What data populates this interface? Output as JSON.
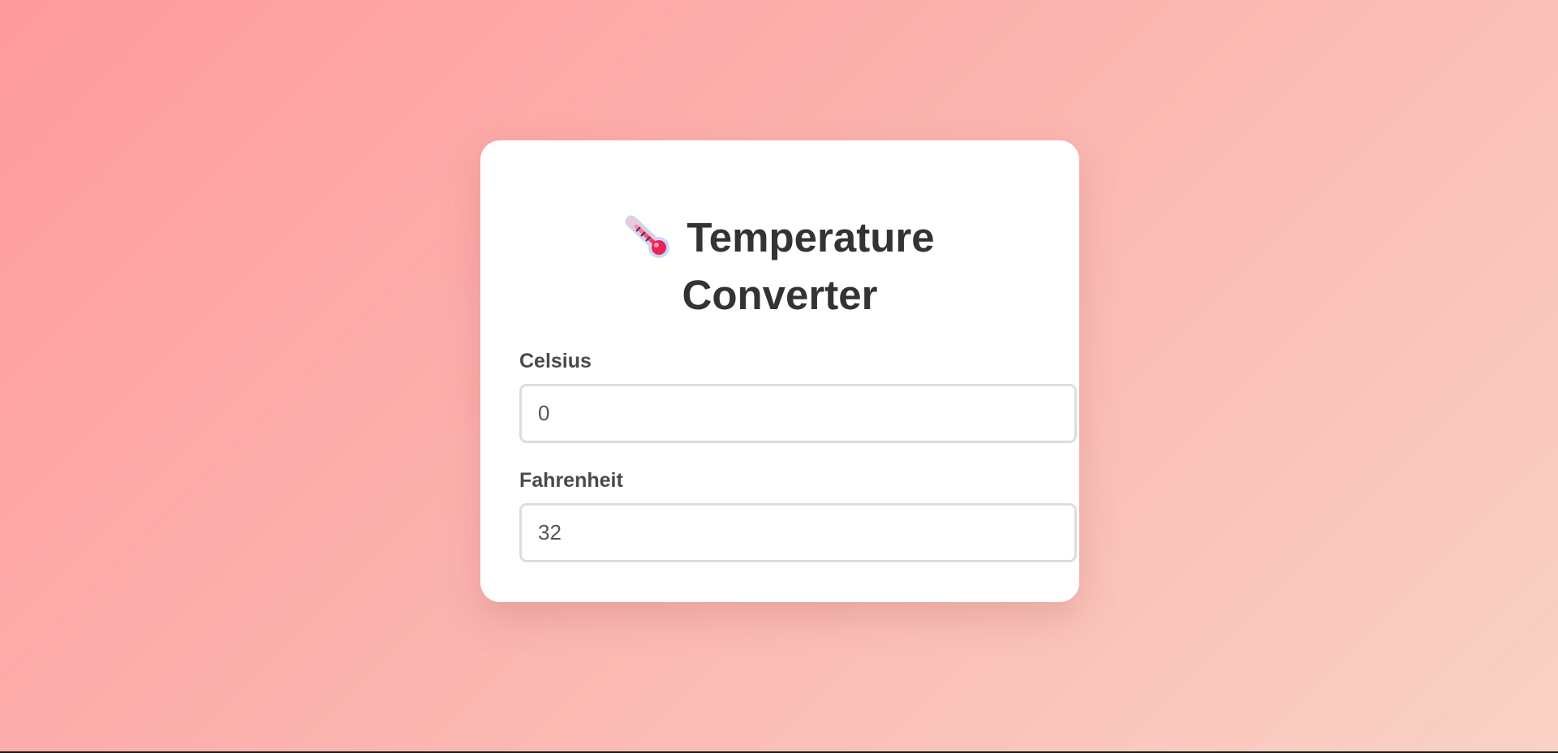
{
  "page": {
    "title_line1": "Temperature",
    "title_line2": "Converter",
    "title_icon": "thermometer-icon"
  },
  "fields": [
    {
      "label": "Celsius",
      "value": "0"
    },
    {
      "label": "Fahrenheit",
      "value": "32"
    }
  ],
  "colors": {
    "background_start": "#ff9a9e",
    "background_end": "#f9d2c5",
    "card": "#ffffff",
    "title_text": "#333333",
    "label_text": "#4a4a4a",
    "input_border": "#dddddd",
    "thermometer_red": "#e8245a"
  }
}
